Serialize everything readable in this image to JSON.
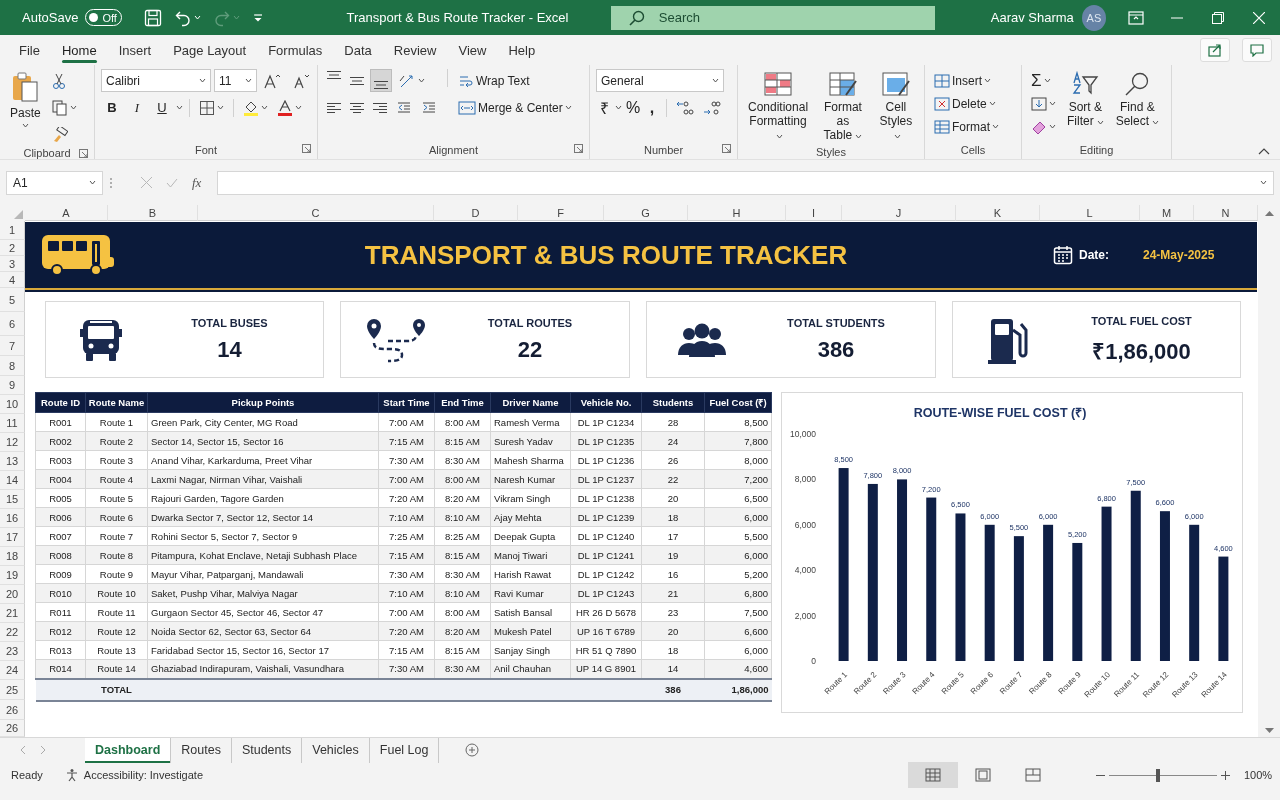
{
  "title_bar": {
    "autosave_label": "AutoSave",
    "autosave": {
      "on": false,
      "label": "Off"
    },
    "redo_disabled": true,
    "title": "Transport & Bus Route Tracker - Excel",
    "search": {
      "placeholder": "Search"
    },
    "user_name": "Aarav Sharma",
    "avatar": "AS"
  },
  "ribbon_tabs": [
    {
      "label": "File",
      "selected": false
    },
    {
      "label": "Home",
      "selected": true
    },
    {
      "label": "Insert",
      "selected": false
    },
    {
      "label": "Page Layout",
      "selected": false
    },
    {
      "label": "Formulas",
      "selected": false
    },
    {
      "label": "Data",
      "selected": false
    },
    {
      "label": "Review",
      "selected": false
    },
    {
      "label": "View",
      "selected": false
    },
    {
      "label": "Help",
      "selected": false
    }
  ],
  "ribbon": {
    "groups": [
      {
        "kind": "clipboard",
        "label": "Clipboard",
        "paste": "Paste"
      },
      {
        "kind": "font",
        "label": "Font",
        "font_name": "Calibri",
        "font_size": "11",
        "styles": [
          "B",
          "I",
          "U"
        ]
      },
      {
        "kind": "alignment",
        "label": "Alignment",
        "align_buttons": [
          {
            "kind": "top",
            "selected": false
          },
          {
            "kind": "middle",
            "selected": false
          },
          {
            "kind": "bottom",
            "selected": true
          },
          {
            "kind": "left",
            "selected": false
          },
          {
            "kind": "center",
            "selected": false
          },
          {
            "kind": "right",
            "selected": false
          }
        ],
        "wrap_text": "Wrap Text",
        "merge": "Merge & Center"
      },
      {
        "kind": "number",
        "label": "Number",
        "format": "General",
        "symbols": [
          "₹",
          "%",
          ","
        ]
      },
      {
        "kind": "styles",
        "label": "Styles",
        "buttons": [
          [
            "Conditional",
            "Formatting"
          ],
          [
            "Format as",
            "Table"
          ],
          [
            "Cell",
            "Styles"
          ]
        ]
      },
      {
        "kind": "cells",
        "label": "Cells",
        "buttons": [
          "Insert",
          "Delete",
          "Format"
        ]
      },
      {
        "kind": "editing",
        "label": "Editing",
        "sum": "Σ",
        "buttons": [
          [
            "Sort &",
            "Filter"
          ],
          [
            "Find &",
            "Select"
          ]
        ]
      }
    ]
  },
  "formula_bar": {
    "name_box": "A1",
    "function_label": "fx"
  },
  "columns": [
    "A",
    "B",
    "C",
    "D",
    "F",
    "G",
    "H",
    "I",
    "J",
    "K",
    "L",
    "M",
    "N"
  ],
  "rows": [
    "1",
    "2",
    "3",
    "4",
    "5",
    "6",
    "7",
    "8",
    "9",
    "10",
    "11",
    "12",
    "13",
    "14",
    "15",
    "16",
    "17",
    "18",
    "19",
    "20",
    "21",
    "22",
    "23",
    "24",
    "25",
    "26",
    "26"
  ],
  "banner": {
    "title": "TRANSPORT & BUS ROUTE TRACKER",
    "date_label": "Date:",
    "date": "24-May-2025"
  },
  "kpis": [
    {
      "kind": "bus",
      "label": "TOTAL BUSES",
      "value": "14"
    },
    {
      "kind": "route",
      "label": "TOTAL ROUTES",
      "value": "22"
    },
    {
      "kind": "people",
      "label": "TOTAL STUDENTS",
      "value": "386"
    },
    {
      "kind": "fuel",
      "label": "TOTAL FUEL COST",
      "value": "₹1,86,000"
    }
  ],
  "table": {
    "columns": [
      "Route ID",
      "Route Name",
      "Pickup Points",
      "Start Time",
      "End Time",
      "Driver Name",
      "Vehicle No.",
      "Students",
      "Fuel Cost (₹)"
    ],
    "rows": [
      [
        "R001",
        "Route 1",
        "Green Park, City Center, MG Road",
        "7:00 AM",
        "8:00 AM",
        "Ramesh Verma",
        "DL 1P C1234",
        "28",
        "8,500"
      ],
      [
        "R002",
        "Route 2",
        "Sector 14, Sector 15, Sector 16",
        "7:15 AM",
        "8:15 AM",
        "Suresh Yadav",
        "DL 1P C1235",
        "24",
        "7,800"
      ],
      [
        "R003",
        "Route 3",
        "Anand Vihar, Karkarduma, Preet Vihar",
        "7:30 AM",
        "8:30 AM",
        "Mahesh Sharma",
        "DL 1P C1236",
        "26",
        "8,000"
      ],
      [
        "R004",
        "Route 4",
        "Laxmi Nagar, Nirman Vihar, Vaishali",
        "7:00 AM",
        "8:00 AM",
        "Naresh Kumar",
        "DL 1P C1237",
        "22",
        "7,200"
      ],
      [
        "R005",
        "Route 5",
        "Rajouri Garden, Tagore Garden",
        "7:20 AM",
        "8:20 AM",
        "Vikram Singh",
        "DL 1P C1238",
        "20",
        "6,500"
      ],
      [
        "R006",
        "Route 6",
        "Dwarka Sector 7, Sector 12, Sector 14",
        "7:10 AM",
        "8:10 AM",
        "Ajay Mehta",
        "DL 1P C1239",
        "18",
        "6,000"
      ],
      [
        "R007",
        "Route 7",
        "Rohini Sector 5, Sector 7, Sector 9",
        "7:25 AM",
        "8:25 AM",
        "Deepak Gupta",
        "DL 1P C1240",
        "17",
        "5,500"
      ],
      [
        "R008",
        "Route 8",
        "Pitampura, Kohat Enclave, Netaji Subhash Place",
        "7:15 AM",
        "8:15 AM",
        "Manoj Tiwari",
        "DL 1P C1241",
        "19",
        "6,000"
      ],
      [
        "R009",
        "Route 9",
        "Mayur Vihar, Patparganj, Mandawali",
        "7:30 AM",
        "8:30 AM",
        "Harish Rawat",
        "DL 1P C1242",
        "16",
        "5,200"
      ],
      [
        "R010",
        "Route 10",
        "Saket, Pushp Vihar, Malviya Nagar",
        "7:10 AM",
        "8:10 AM",
        "Ravi Kumar",
        "DL 1P C1243",
        "21",
        "6,800"
      ],
      [
        "R011",
        "Route 11",
        "Gurgaon Sector 45, Sector 46, Sector 47",
        "7:00 AM",
        "8:00 AM",
        "Satish Bansal",
        "HR 26 D 5678",
        "23",
        "7,500"
      ],
      [
        "R012",
        "Route 12",
        "Noida Sector 62, Sector 63, Sector 64",
        "7:20 AM",
        "8:20 AM",
        "Mukesh Patel",
        "UP 16 T 6789",
        "20",
        "6,600"
      ],
      [
        "R013",
        "Route 13",
        "Faridabad Sector 15, Sector 16, Sector 17",
        "7:15 AM",
        "8:15 AM",
        "Sanjay Singh",
        "HR 51 Q 7890",
        "18",
        "6,000"
      ],
      [
        "R014",
        "Route 14",
        "Ghaziabad Indirapuram, Vaishali, Vasundhara",
        "7:30 AM",
        "8:30 AM",
        "Anil Chauhan",
        "UP 14 G 8901",
        "14",
        "4,600"
      ]
    ],
    "total": {
      "label": "TOTAL",
      "students": "386",
      "fuel_cost": "1,86,000"
    }
  },
  "chart": {
    "chart_data": {
      "type": "bar",
      "title": "ROUTE-WISE FUEL COST (₹)",
      "categories": [
        "Route 1",
        "Route 2",
        "Route 3",
        "Route 4",
        "Route 5",
        "Route 6",
        "Route 7",
        "Route 8",
        "Route 9",
        "Route 10",
        "Route 11",
        "Route 12",
        "Route 13",
        "Route 14"
      ],
      "series": [
        {
          "color": "#0f1f45",
          "values": [
            8500,
            7800,
            8000,
            7200,
            6500,
            6000,
            5500,
            6000,
            5200,
            6800,
            7500,
            6600,
            6000,
            4600
          ]
        }
      ],
      "ylim": [
        0,
        10000
      ],
      "yticks": [
        0,
        {
          "value": 2000,
          "label": "2,000"
        },
        {
          "value": 4000,
          "label": "4,000"
        },
        {
          "value": 6000,
          "label": "6,000"
        },
        {
          "value": 8000,
          "label": "8,000"
        },
        {
          "value": 10000,
          "label": "10,000"
        }
      ],
      "value_labels": [
        "8,500",
        "7,800",
        "8,000",
        "7,200",
        "6,500",
        "6,000",
        "5,500",
        "6,000",
        "5,200",
        "6,800",
        "7,500",
        "6,600",
        "6,000",
        "4,600"
      ]
    }
  },
  "sheet_tabs": [
    {
      "label": "Dashboard",
      "selected": true
    },
    {
      "label": "Routes",
      "selected": false
    },
    {
      "label": "Students",
      "selected": false
    },
    {
      "label": "Vehicles",
      "selected": false
    },
    {
      "label": "Fuel Log",
      "selected": false
    }
  ],
  "status_bar": {
    "status": "Ready",
    "accessibility": "Accessibility: Investigate",
    "views": [
      {
        "kind": "normal",
        "selected": true
      },
      {
        "kind": "page_layout",
        "selected": false
      },
      {
        "kind": "page_break",
        "selected": false
      }
    ],
    "zoom": {
      "level": 0.45,
      "reading": "100%"
    }
  }
}
